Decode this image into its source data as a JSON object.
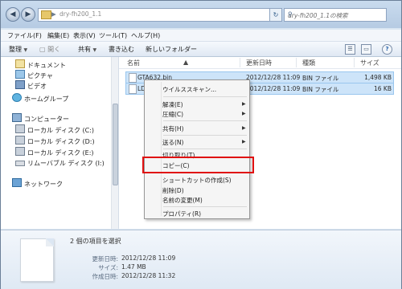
{
  "address": {
    "path": "dry-fh200_1.1",
    "arrow": "▶"
  },
  "search": {
    "placeholder": "dry-fh200_1.1の検索"
  },
  "menu": [
    "ファイル(F)",
    "編集(E)",
    "表示(V)",
    "ツール(T)",
    "ヘルプ(H)"
  ],
  "toolbar": {
    "organize": "整理",
    "open": "開く",
    "share": "共有",
    "burn": "書き込む",
    "new_folder": "新しいフォルダー"
  },
  "nav": {
    "documents": "ドキュメント",
    "pictures": "ピクチャ",
    "videos": "ビデオ",
    "homegroup": "ホームグループ",
    "computer": "コンピューター",
    "disk_c": "ローカル ディスク (C:)",
    "disk_d": "ローカル ディスク (D:)",
    "disk_e": "ローカル ディスク (E:)",
    "removable": "リムーバブル ディスク (I:)",
    "network": "ネットワーク"
  },
  "columns": {
    "name": "名前",
    "date": "更新日時",
    "type": "種類",
    "size": "サイズ"
  },
  "files": [
    {
      "name": "GTA632.bin",
      "date": "2012/12/28 11:09",
      "type": "BIN ファイル",
      "size": "1,498 KB"
    },
    {
      "name": "LDC",
      "date": "2012/12/28 11:09",
      "type": "BIN ファイル",
      "size": "16 KB"
    }
  ],
  "context_menu": {
    "virus_scan": "ウイルススキャン...",
    "extract": "解凍(E)",
    "compress": "圧縮(C)",
    "share": "共有(H)",
    "send_to": "送る(N)",
    "cut": "切り取り(T)",
    "copy": "コピー(C)",
    "shortcut": "ショートカットの作成(S)",
    "delete": "削除(D)",
    "rename": "名前の変更(M)",
    "properties": "プロパティ(R)"
  },
  "details": {
    "selected": "2 個の項目を選択",
    "modified_label": "更新日時:",
    "modified": "2012/12/28 11:09",
    "size_label": "サイズ:",
    "size": "1.47 MB",
    "created_label": "作成日時:",
    "created": "2012/12/28 11:32"
  }
}
